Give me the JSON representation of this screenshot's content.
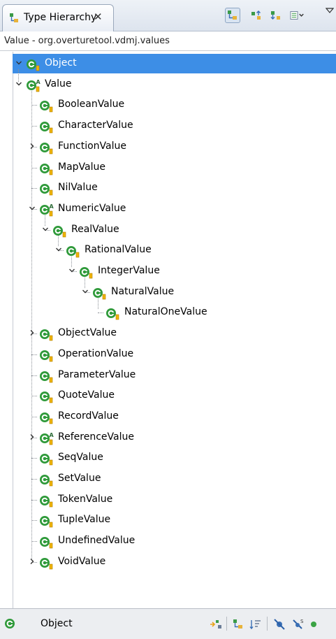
{
  "view": {
    "title": "Type Hierarchy",
    "close_glyph": "✕",
    "toolbar": [
      {
        "name": "show-type-hierarchy",
        "icon": "type-hierarchy-icon",
        "pressed": true
      },
      {
        "name": "show-supertype-hierarchy",
        "icon": "supertype-hierarchy-icon",
        "pressed": false
      },
      {
        "name": "show-subtype-hierarchy",
        "icon": "subtype-hierarchy-icon",
        "pressed": false
      },
      {
        "name": "history",
        "icon": "history-icon",
        "pressed": false
      }
    ]
  },
  "infobar": {
    "text": "Value - org.overturetool.vdmj.values"
  },
  "tree": {
    "root": {
      "label": "Object",
      "selected": true
    },
    "rows": [
      {
        "label": "Value",
        "abstract": true,
        "expanded": true
      },
      {
        "label": "BooleanValue"
      },
      {
        "label": "CharacterValue"
      },
      {
        "label": "FunctionValue",
        "collapsed": true
      },
      {
        "label": "MapValue"
      },
      {
        "label": "NilValue"
      },
      {
        "label": "NumericValue",
        "abstract": true,
        "expanded": true
      },
      {
        "label": "RealValue",
        "expanded": true
      },
      {
        "label": "RationalValue",
        "expanded": true
      },
      {
        "label": "IntegerValue",
        "expanded": true
      },
      {
        "label": "NaturalValue",
        "expanded": true
      },
      {
        "label": "NaturalOneValue"
      },
      {
        "label": "ObjectValue",
        "collapsed": true
      },
      {
        "label": "OperationValue"
      },
      {
        "label": "ParameterValue"
      },
      {
        "label": "QuoteValue"
      },
      {
        "label": "RecordValue"
      },
      {
        "label": "ReferenceValue",
        "abstract": true,
        "collapsed": true
      },
      {
        "label": "SeqValue"
      },
      {
        "label": "SetValue"
      },
      {
        "label": "TokenValue"
      },
      {
        "label": "TupleValue"
      },
      {
        "label": "UndefinedValue"
      },
      {
        "label": "VoidValue",
        "collapsed": true
      }
    ]
  },
  "status": {
    "label": "Object"
  },
  "colors": {
    "selection": "#3d8ee6",
    "class_icon": "#2f9a3a",
    "final_badge": "#f0b400"
  }
}
